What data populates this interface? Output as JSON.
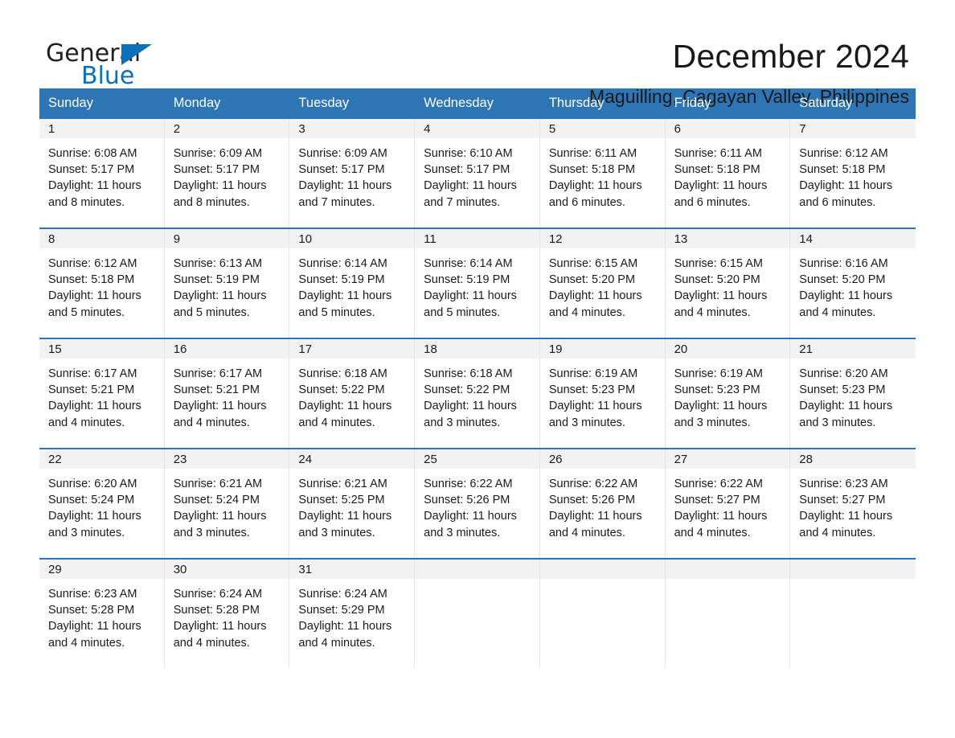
{
  "brand": {
    "name_part1": "General",
    "name_part2": "Blue",
    "triangle_color": "#0b6fba",
    "text_color": "#231f20"
  },
  "header": {
    "month_title": "December 2024",
    "location": "Maguilling, Cagayan Valley, Philippines"
  },
  "theme": {
    "header_blue": "#2e75b6",
    "row_divider_blue": "#2e75b6",
    "daynum_strip_gray": "#f2f2f2",
    "cell_border": "#e6e6e6",
    "text": "#1a1a1a",
    "header_text": "#ffffff"
  },
  "calendar": {
    "day_names": [
      "Sunday",
      "Monday",
      "Tuesday",
      "Wednesday",
      "Thursday",
      "Friday",
      "Saturday"
    ],
    "labels": {
      "sunrise_prefix": "Sunrise:",
      "sunset_prefix": "Sunset:",
      "daylight_prefix": "Daylight:"
    },
    "weeks": [
      [
        {
          "day": "1",
          "sunrise": "Sunrise: 6:08 AM",
          "sunset": "Sunset: 5:17 PM",
          "daylight_line1": "Daylight: 11 hours",
          "daylight_line2": "and 8 minutes."
        },
        {
          "day": "2",
          "sunrise": "Sunrise: 6:09 AM",
          "sunset": "Sunset: 5:17 PM",
          "daylight_line1": "Daylight: 11 hours",
          "daylight_line2": "and 8 minutes."
        },
        {
          "day": "3",
          "sunrise": "Sunrise: 6:09 AM",
          "sunset": "Sunset: 5:17 PM",
          "daylight_line1": "Daylight: 11 hours",
          "daylight_line2": "and 7 minutes."
        },
        {
          "day": "4",
          "sunrise": "Sunrise: 6:10 AM",
          "sunset": "Sunset: 5:17 PM",
          "daylight_line1": "Daylight: 11 hours",
          "daylight_line2": "and 7 minutes."
        },
        {
          "day": "5",
          "sunrise": "Sunrise: 6:11 AM",
          "sunset": "Sunset: 5:18 PM",
          "daylight_line1": "Daylight: 11 hours",
          "daylight_line2": "and 6 minutes."
        },
        {
          "day": "6",
          "sunrise": "Sunrise: 6:11 AM",
          "sunset": "Sunset: 5:18 PM",
          "daylight_line1": "Daylight: 11 hours",
          "daylight_line2": "and 6 minutes."
        },
        {
          "day": "7",
          "sunrise": "Sunrise: 6:12 AM",
          "sunset": "Sunset: 5:18 PM",
          "daylight_line1": "Daylight: 11 hours",
          "daylight_line2": "and 6 minutes."
        }
      ],
      [
        {
          "day": "8",
          "sunrise": "Sunrise: 6:12 AM",
          "sunset": "Sunset: 5:18 PM",
          "daylight_line1": "Daylight: 11 hours",
          "daylight_line2": "and 5 minutes."
        },
        {
          "day": "9",
          "sunrise": "Sunrise: 6:13 AM",
          "sunset": "Sunset: 5:19 PM",
          "daylight_line1": "Daylight: 11 hours",
          "daylight_line2": "and 5 minutes."
        },
        {
          "day": "10",
          "sunrise": "Sunrise: 6:14 AM",
          "sunset": "Sunset: 5:19 PM",
          "daylight_line1": "Daylight: 11 hours",
          "daylight_line2": "and 5 minutes."
        },
        {
          "day": "11",
          "sunrise": "Sunrise: 6:14 AM",
          "sunset": "Sunset: 5:19 PM",
          "daylight_line1": "Daylight: 11 hours",
          "daylight_line2": "and 5 minutes."
        },
        {
          "day": "12",
          "sunrise": "Sunrise: 6:15 AM",
          "sunset": "Sunset: 5:20 PM",
          "daylight_line1": "Daylight: 11 hours",
          "daylight_line2": "and 4 minutes."
        },
        {
          "day": "13",
          "sunrise": "Sunrise: 6:15 AM",
          "sunset": "Sunset: 5:20 PM",
          "daylight_line1": "Daylight: 11 hours",
          "daylight_line2": "and 4 minutes."
        },
        {
          "day": "14",
          "sunrise": "Sunrise: 6:16 AM",
          "sunset": "Sunset: 5:20 PM",
          "daylight_line1": "Daylight: 11 hours",
          "daylight_line2": "and 4 minutes."
        }
      ],
      [
        {
          "day": "15",
          "sunrise": "Sunrise: 6:17 AM",
          "sunset": "Sunset: 5:21 PM",
          "daylight_line1": "Daylight: 11 hours",
          "daylight_line2": "and 4 minutes."
        },
        {
          "day": "16",
          "sunrise": "Sunrise: 6:17 AM",
          "sunset": "Sunset: 5:21 PM",
          "daylight_line1": "Daylight: 11 hours",
          "daylight_line2": "and 4 minutes."
        },
        {
          "day": "17",
          "sunrise": "Sunrise: 6:18 AM",
          "sunset": "Sunset: 5:22 PM",
          "daylight_line1": "Daylight: 11 hours",
          "daylight_line2": "and 4 minutes."
        },
        {
          "day": "18",
          "sunrise": "Sunrise: 6:18 AM",
          "sunset": "Sunset: 5:22 PM",
          "daylight_line1": "Daylight: 11 hours",
          "daylight_line2": "and 3 minutes."
        },
        {
          "day": "19",
          "sunrise": "Sunrise: 6:19 AM",
          "sunset": "Sunset: 5:23 PM",
          "daylight_line1": "Daylight: 11 hours",
          "daylight_line2": "and 3 minutes."
        },
        {
          "day": "20",
          "sunrise": "Sunrise: 6:19 AM",
          "sunset": "Sunset: 5:23 PM",
          "daylight_line1": "Daylight: 11 hours",
          "daylight_line2": "and 3 minutes."
        },
        {
          "day": "21",
          "sunrise": "Sunrise: 6:20 AM",
          "sunset": "Sunset: 5:23 PM",
          "daylight_line1": "Daylight: 11 hours",
          "daylight_line2": "and 3 minutes."
        }
      ],
      [
        {
          "day": "22",
          "sunrise": "Sunrise: 6:20 AM",
          "sunset": "Sunset: 5:24 PM",
          "daylight_line1": "Daylight: 11 hours",
          "daylight_line2": "and 3 minutes."
        },
        {
          "day": "23",
          "sunrise": "Sunrise: 6:21 AM",
          "sunset": "Sunset: 5:24 PM",
          "daylight_line1": "Daylight: 11 hours",
          "daylight_line2": "and 3 minutes."
        },
        {
          "day": "24",
          "sunrise": "Sunrise: 6:21 AM",
          "sunset": "Sunset: 5:25 PM",
          "daylight_line1": "Daylight: 11 hours",
          "daylight_line2": "and 3 minutes."
        },
        {
          "day": "25",
          "sunrise": "Sunrise: 6:22 AM",
          "sunset": "Sunset: 5:26 PM",
          "daylight_line1": "Daylight: 11 hours",
          "daylight_line2": "and 3 minutes."
        },
        {
          "day": "26",
          "sunrise": "Sunrise: 6:22 AM",
          "sunset": "Sunset: 5:26 PM",
          "daylight_line1": "Daylight: 11 hours",
          "daylight_line2": "and 4 minutes."
        },
        {
          "day": "27",
          "sunrise": "Sunrise: 6:22 AM",
          "sunset": "Sunset: 5:27 PM",
          "daylight_line1": "Daylight: 11 hours",
          "daylight_line2": "and 4 minutes."
        },
        {
          "day": "28",
          "sunrise": "Sunrise: 6:23 AM",
          "sunset": "Sunset: 5:27 PM",
          "daylight_line1": "Daylight: 11 hours",
          "daylight_line2": "and 4 minutes."
        }
      ],
      [
        {
          "day": "29",
          "sunrise": "Sunrise: 6:23 AM",
          "sunset": "Sunset: 5:28 PM",
          "daylight_line1": "Daylight: 11 hours",
          "daylight_line2": "and 4 minutes."
        },
        {
          "day": "30",
          "sunrise": "Sunrise: 6:24 AM",
          "sunset": "Sunset: 5:28 PM",
          "daylight_line1": "Daylight: 11 hours",
          "daylight_line2": "and 4 minutes."
        },
        {
          "day": "31",
          "sunrise": "Sunrise: 6:24 AM",
          "sunset": "Sunset: 5:29 PM",
          "daylight_line1": "Daylight: 11 hours",
          "daylight_line2": "and 4 minutes."
        },
        {
          "day": "",
          "sunrise": "",
          "sunset": "",
          "daylight_line1": "",
          "daylight_line2": ""
        },
        {
          "day": "",
          "sunrise": "",
          "sunset": "",
          "daylight_line1": "",
          "daylight_line2": ""
        },
        {
          "day": "",
          "sunrise": "",
          "sunset": "",
          "daylight_line1": "",
          "daylight_line2": ""
        },
        {
          "day": "",
          "sunrise": "",
          "sunset": "",
          "daylight_line1": "",
          "daylight_line2": ""
        }
      ]
    ]
  }
}
